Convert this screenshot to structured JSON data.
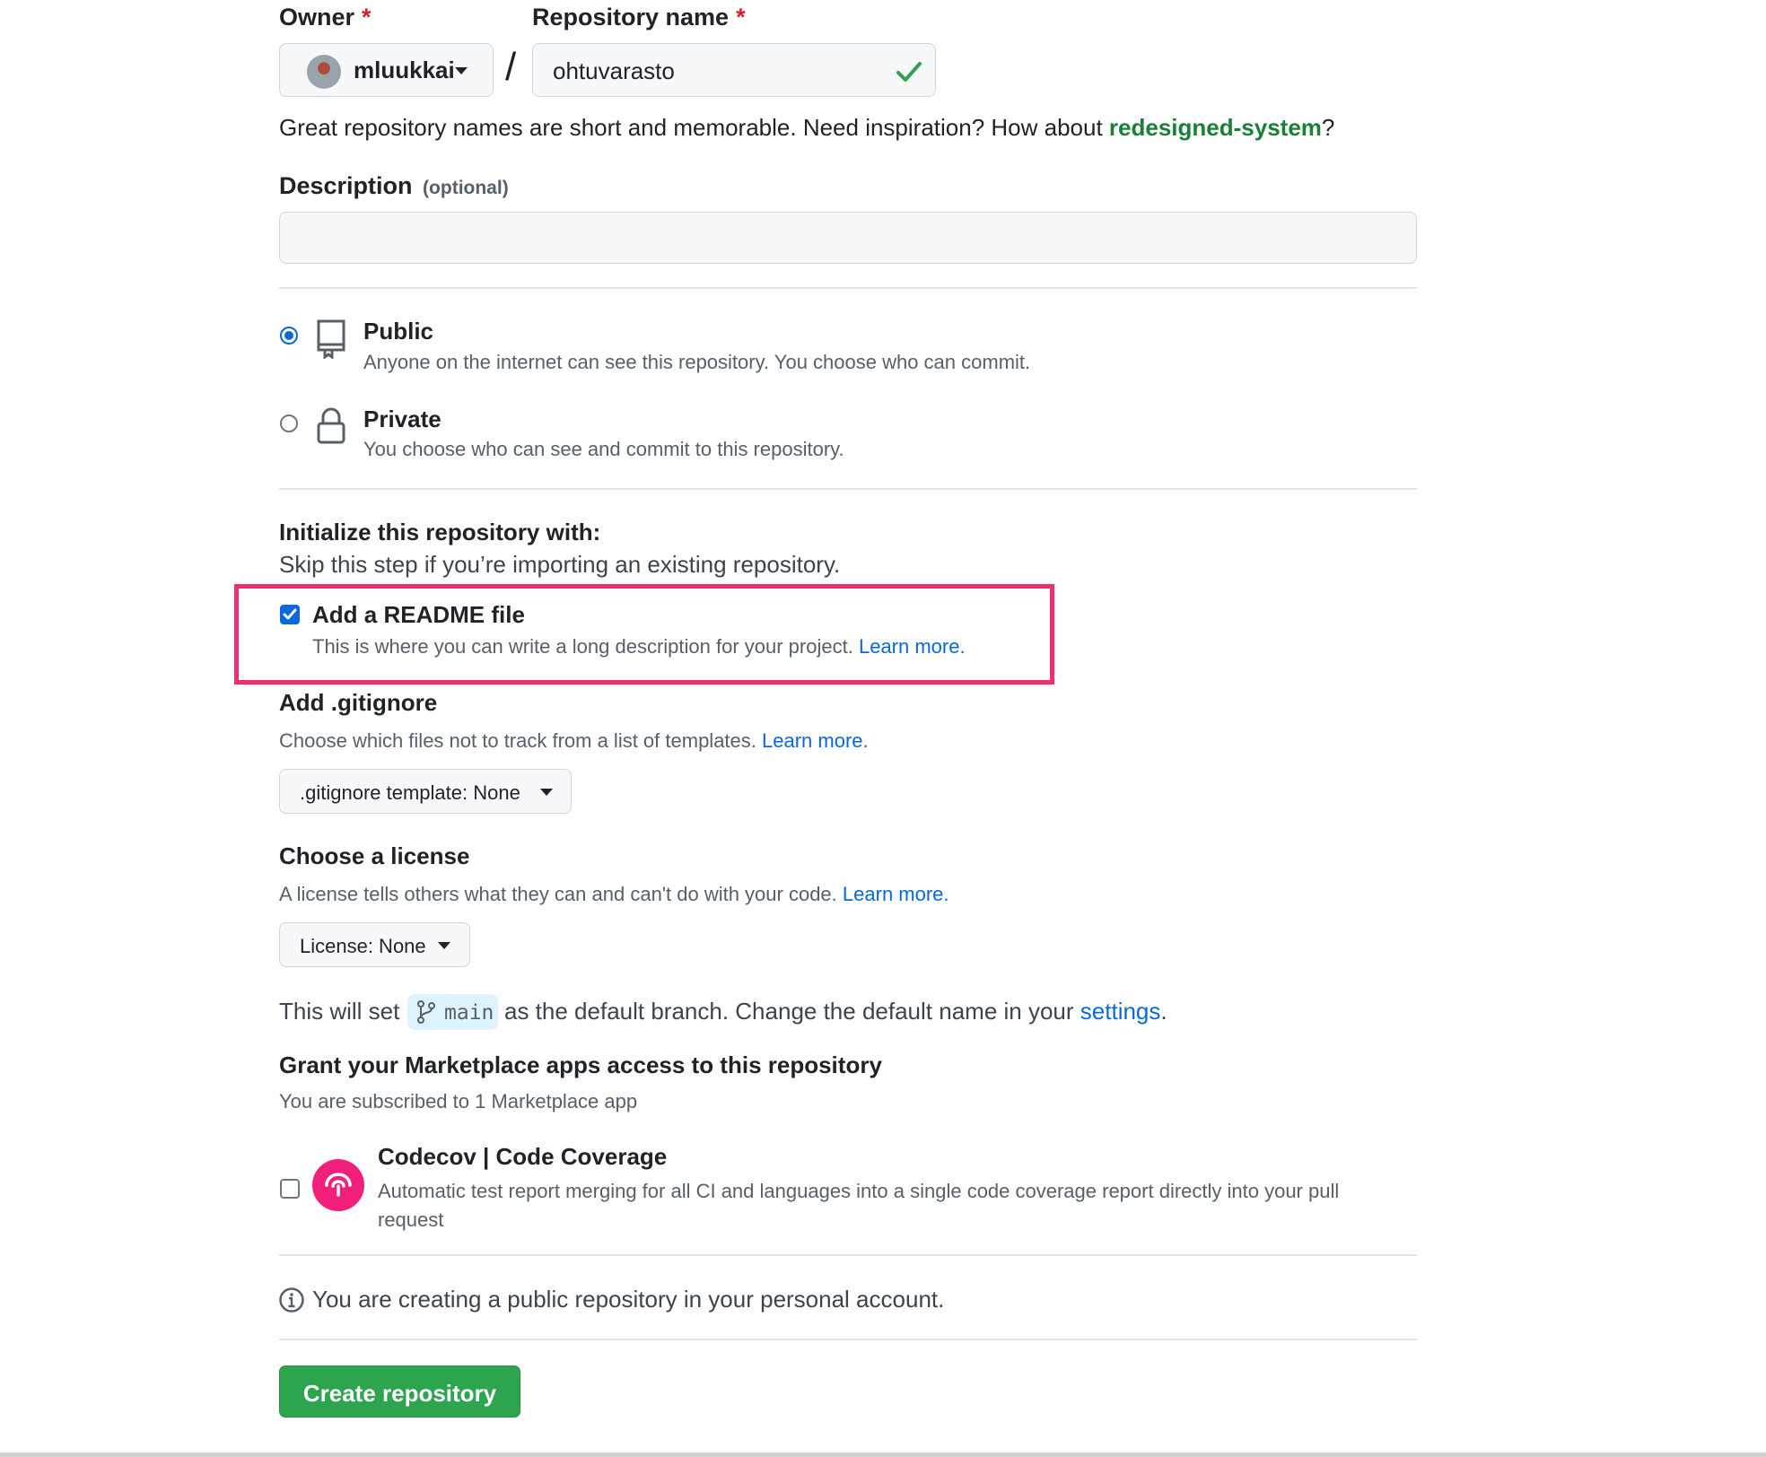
{
  "owner_section": {
    "owner_label": "Owner",
    "required_mark": "*",
    "owner_value": "mluukkai",
    "separator": "/",
    "repo_label": "Repository name",
    "repo_value": "ohtuvarasto"
  },
  "name_hint": {
    "text": "Great repository names are short and memorable. Need inspiration? How about ",
    "suggestion": "redesigned-system",
    "suffix": "?"
  },
  "description": {
    "label": "Description",
    "optional": "(optional)",
    "value": ""
  },
  "visibility": {
    "public_title": "Public",
    "public_desc": "Anyone on the internet can see this repository. You choose who can commit.",
    "private_title": "Private",
    "private_desc": "You choose who can see and commit to this repository.",
    "selected": "Public"
  },
  "initialize": {
    "title": "Initialize this repository with:",
    "subtitle": "Skip this step if you’re importing an existing repository.",
    "readme_label": "Add a README file",
    "readme_desc": "This is where you can write a long description for your project.",
    "readme_learn": "Learn more.",
    "readme_checked": true
  },
  "gitignore": {
    "title": "Add .gitignore",
    "desc": "Choose which files not to track from a list of templates.",
    "learn": "Learn more.",
    "select": ".gitignore template: None"
  },
  "license": {
    "title": "Choose a license",
    "desc": "A license tells others what they can and can't do with your code.",
    "learn": "Learn more.",
    "select": "License: None"
  },
  "branch": {
    "prefix": "This will set",
    "branch_name": "main",
    "middle": "as the default branch. Change the default name in your",
    "settings_link": "settings",
    "suffix": "."
  },
  "marketplace": {
    "title": "Grant your Marketplace apps access to this repository",
    "subtitle": "You are subscribed to 1 Marketplace app",
    "app_name": "Codecov | Code Coverage",
    "app_desc_line1": "Automatic test report merging for all CI and languages into a single code coverage report directly into your pull",
    "app_desc_line2": "request",
    "app_checked": false
  },
  "notice": {
    "text": "You are creating a public repository in your personal account."
  },
  "submit": {
    "label": "Create repository"
  },
  "colors": {
    "accent": "#0969da",
    "success": "#2da44e",
    "highlight": "#f0306e",
    "codecov": "#f01f7a"
  }
}
